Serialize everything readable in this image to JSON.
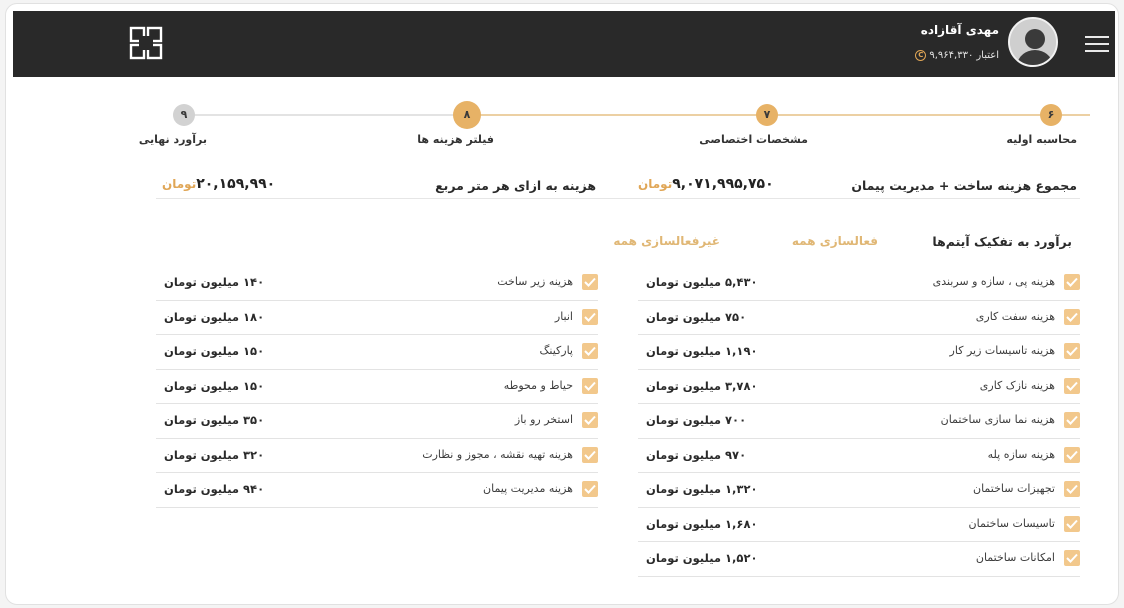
{
  "header": {
    "username": "مهدی آقازاده",
    "credit_label": "اعتبار",
    "credit_value": "۹,۹۶۴,۳۳۰",
    "credit_icon": "coin-icon",
    "menu_icon": "hamburger-icon",
    "logo_icon": "app-logo"
  },
  "stepper": {
    "steps": [
      {
        "number": "۶",
        "label": "محاسبه اولیه",
        "state": "done"
      },
      {
        "number": "۷",
        "label": "مشخصات اختصاصی",
        "state": "done"
      },
      {
        "number": "۸",
        "label": "فیلتر هزینه ها",
        "state": "current"
      },
      {
        "number": "۹",
        "label": "برآورد نهایی",
        "state": "upcoming"
      }
    ]
  },
  "totals": {
    "build_label": "مجموع هزینه ساخت + مدیریت پیمان",
    "build_value": "۹,۰۷۱,۹۹۵,۷۵۰",
    "per_meter_label": "هزینه به ازای هر متر مربع",
    "per_meter_value": "۲۰,۱۵۹,۹۹۰",
    "unit": "تومان"
  },
  "breakdown": {
    "title": "برآورد به تفکیک آیتم‌ها",
    "activate_all": "فعالسازی همه",
    "deactivate_all": "غیرفعالسازی همه"
  },
  "items_right": [
    {
      "label": "هزینه پی ، سازه و سربندی",
      "amount": "۵,۴۳۰",
      "unit": "میلیون تومان",
      "checked": true
    },
    {
      "label": "هزینه سفت کاری",
      "amount": "۷۵۰",
      "unit": "میلیون تومان",
      "checked": true
    },
    {
      "label": "هزینه تاسیسات زیر کار",
      "amount": "۱,۱۹۰",
      "unit": "میلیون تومان",
      "checked": true
    },
    {
      "label": "هزینه نازک کاری",
      "amount": "۳,۷۸۰",
      "unit": "میلیون تومان",
      "checked": true
    },
    {
      "label": "هزینه نما سازی ساختمان",
      "amount": "۷۰۰",
      "unit": "میلیون تومان",
      "checked": true
    },
    {
      "label": "هزینه سازه پله",
      "amount": "۹۷۰",
      "unit": "میلیون تومان",
      "checked": true
    },
    {
      "label": "تجهیزات ساختمان",
      "amount": "۱,۳۲۰",
      "unit": "میلیون تومان",
      "checked": true
    },
    {
      "label": "تاسیسات ساختمان",
      "amount": "۱,۶۸۰",
      "unit": "میلیون تومان",
      "checked": true
    },
    {
      "label": "امکانات ساختمان",
      "amount": "۱,۵۲۰",
      "unit": "میلیون تومان",
      "checked": true
    }
  ],
  "items_left": [
    {
      "label": "هزینه زیر ساخت",
      "amount": "۱۴۰",
      "unit": "میلیون تومان",
      "checked": true
    },
    {
      "label": "انبار",
      "amount": "۱۸۰",
      "unit": "میلیون تومان",
      "checked": true
    },
    {
      "label": "پارکینگ",
      "amount": "۱۵۰",
      "unit": "میلیون تومان",
      "checked": true
    },
    {
      "label": "حیاط و محوطه",
      "amount": "۱۵۰",
      "unit": "میلیون تومان",
      "checked": true
    },
    {
      "label": "استخر رو باز",
      "amount": "۳۵۰",
      "unit": "میلیون تومان",
      "checked": true
    },
    {
      "label": "هزینه تهیه نقشه ، مجوز و نظارت",
      "amount": "۳۲۰",
      "unit": "میلیون تومان",
      "checked": true
    },
    {
      "label": "هزینه مدیریت پیمان",
      "amount": "۹۴۰",
      "unit": "میلیون تومان",
      "checked": true
    }
  ],
  "colors": {
    "accent": "#e0a656",
    "header_bg": "#292929",
    "checkbox": "#f2c88c"
  }
}
